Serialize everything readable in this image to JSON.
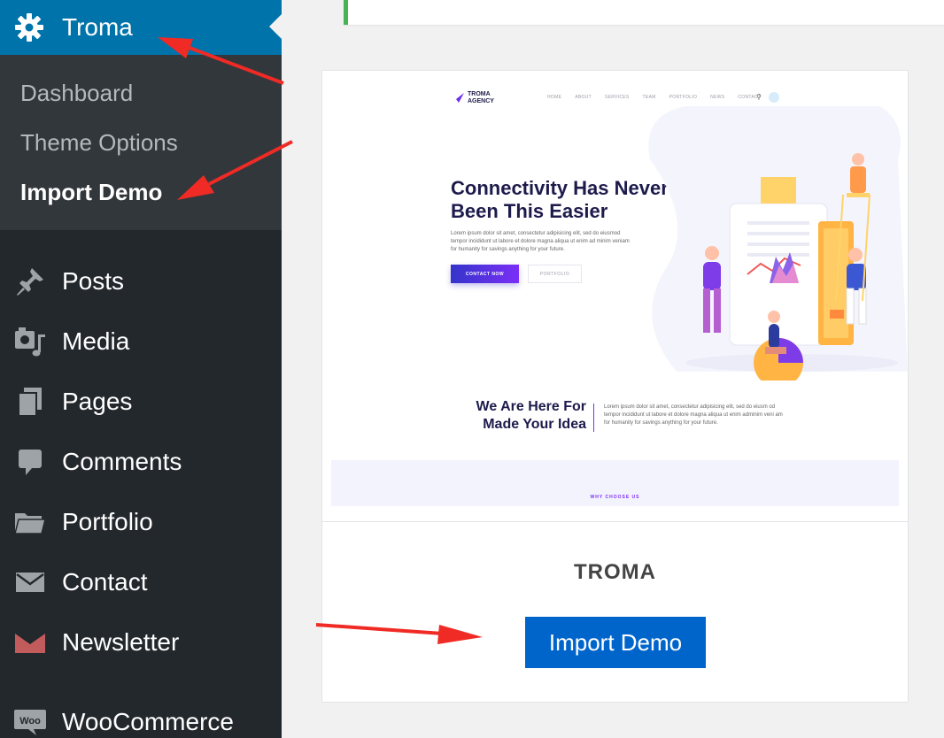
{
  "sidebar": {
    "active_menu": {
      "label": "Troma",
      "icon": "gear-icon"
    },
    "submenu": [
      {
        "label": "Dashboard"
      },
      {
        "label": "Theme Options"
      },
      {
        "label": "Import Demo",
        "current": true
      }
    ],
    "items": [
      {
        "label": "Posts",
        "icon": "pin-icon"
      },
      {
        "label": "Media",
        "icon": "media-icon"
      },
      {
        "label": "Pages",
        "icon": "pages-icon"
      },
      {
        "label": "Comments",
        "icon": "comment-icon"
      },
      {
        "label": "Portfolio",
        "icon": "folder-icon"
      },
      {
        "label": "Contact",
        "icon": "mail-icon"
      },
      {
        "label": "Newsletter",
        "icon": "newsletter-icon"
      },
      {
        "label": "WooCommerce",
        "icon": "woo-icon"
      }
    ]
  },
  "demo": {
    "preview": {
      "logo_line1": "TROMA",
      "logo_line2": "AGENCY",
      "nav": [
        "HOME",
        "ABOUT",
        "SERVICES",
        "TEAM",
        "PORTFOLIO",
        "NEWS",
        "CONTACT"
      ],
      "hero_title": "Connectivity Has Never Been This Easier",
      "hero_body": "Lorem ipsum dolor sit amet, consectetur adipisicing elit, sed do eiusmod tempor incididunt ut labore et dolore magna aliqua ut enim ad minim veniam for humanity for savings anything for your future.",
      "btn_contact": "CONTACT NOW",
      "btn_portfolio": "PORTFOLIO",
      "section_title": "We Are Here For Made Your Idea",
      "section_body": "Lorem ipsum dolor sit amet, consectetur adipisicing elit, sed do eiusm od tempor incididunt ut labore et dolore magna aliqua ut enim adminim veni am for humanity for savings anything for your future.",
      "why_label": "WHY CHOOSE US"
    },
    "theme_name": "TROMA",
    "import_button": "Import Demo"
  },
  "colors": {
    "sidebar_bg": "#23282d",
    "submenu_bg": "#32373c",
    "active_bg": "#0073aa",
    "button_bg": "#0065cb",
    "arrow": "#f02a24",
    "notice_border": "#46b450"
  }
}
